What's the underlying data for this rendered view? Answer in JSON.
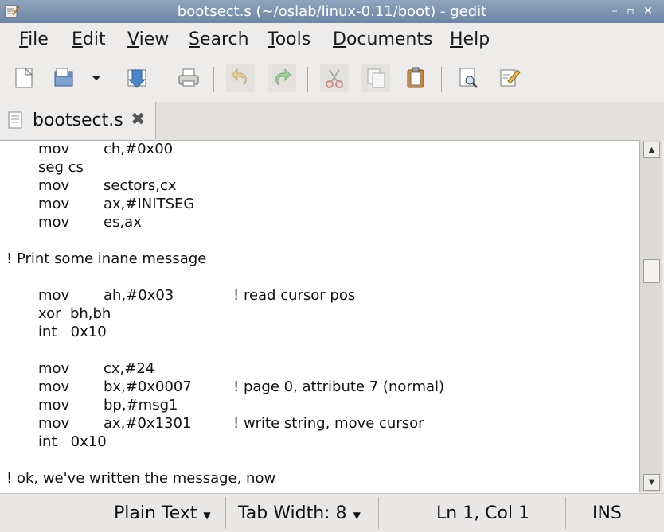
{
  "window": {
    "title": "bootsect.s (~/oslab/linux-0.11/boot) - gedit"
  },
  "menubar": {
    "items": [
      {
        "pre": "",
        "u": "F",
        "post": "ile"
      },
      {
        "pre": "",
        "u": "E",
        "post": "dit"
      },
      {
        "pre": "",
        "u": "V",
        "post": "iew"
      },
      {
        "pre": "",
        "u": "S",
        "post": "earch"
      },
      {
        "pre": "",
        "u": "T",
        "post": "ools"
      },
      {
        "pre": "",
        "u": "D",
        "post": "ocuments"
      },
      {
        "pre": "",
        "u": "H",
        "post": "elp"
      }
    ]
  },
  "toolbar": {
    "icons": [
      "new-document-icon",
      "open-icon",
      "open-dropdown-icon",
      "save-icon",
      "print-icon",
      "undo-icon",
      "redo-icon",
      "cut-icon",
      "copy-icon",
      "paste-icon",
      "find-icon",
      "find-replace-icon"
    ]
  },
  "tab": {
    "label": "bootsect.s"
  },
  "editor": {
    "lines": [
      {
        "a": "mov",
        "b": "ch,#0x00",
        "c": ""
      },
      {
        "a": "seg cs",
        "b": "",
        "c": ""
      },
      {
        "a": "mov",
        "b": "sectors,cx",
        "c": ""
      },
      {
        "a": "mov",
        "b": "ax,#INITSEG",
        "c": ""
      },
      {
        "a": "mov",
        "b": "es,ax",
        "c": ""
      },
      {
        "full": ""
      },
      {
        "full": "! Print some inane message"
      },
      {
        "full": ""
      },
      {
        "a": "mov",
        "b": "ah,#0x03",
        "c": "! read cursor pos"
      },
      {
        "a": "xor  bh,bh",
        "b": "",
        "c": ""
      },
      {
        "a": "int   0x10",
        "b": "",
        "c": ""
      },
      {
        "full": ""
      },
      {
        "a": "mov",
        "b": "cx,#24",
        "c": ""
      },
      {
        "a": "mov",
        "b": "bx,#0x0007",
        "c": "! page 0, attribute 7 (normal)"
      },
      {
        "a": "mov",
        "b": "bp,#msg1",
        "c": ""
      },
      {
        "a": "mov",
        "b": "ax,#0x1301",
        "c": "! write string, move cursor"
      },
      {
        "a": "int   0x10",
        "b": "",
        "c": ""
      },
      {
        "full": ""
      },
      {
        "full": "! ok, we've written the message, now"
      }
    ]
  },
  "statusbar": {
    "language": "Plain Text",
    "tab_width": "Tab Width:  8",
    "position": "Ln 1, Col 1",
    "mode": "INS"
  }
}
